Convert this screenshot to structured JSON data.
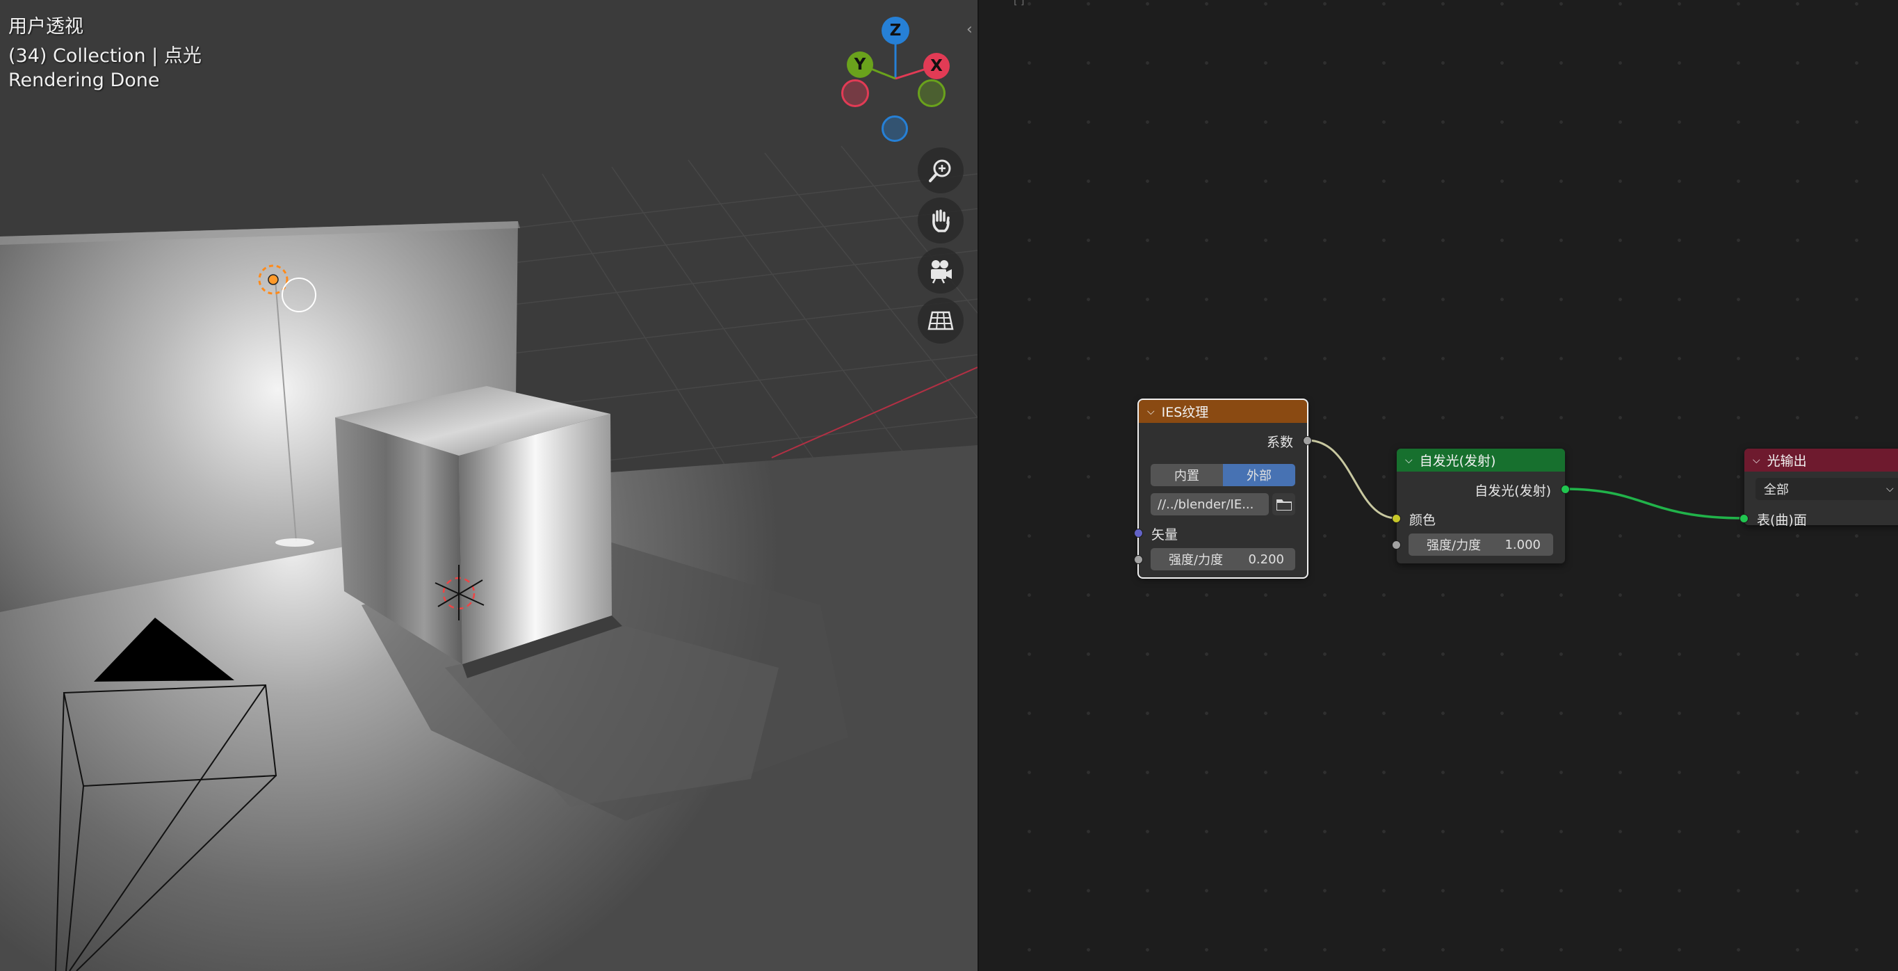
{
  "viewport": {
    "view_name": "用户透视",
    "collection_info": "(34) Collection | 点光",
    "status": "Rendering Done",
    "gizmo": {
      "z": "Z",
      "y": "Y",
      "x": "X"
    },
    "nav_buttons": [
      "zoom-icon",
      "hand-icon",
      "camera-icon",
      "grid-icon"
    ],
    "colors": {
      "x": "#e23b55",
      "y": "#6aa21c",
      "z": "#2680d6"
    }
  },
  "nodes": {
    "ies": {
      "title": "IES纹理",
      "output_factor": "系数",
      "mode_internal": "内置",
      "mode_external": "外部",
      "filepath": "//../blender/IE...",
      "input_vector": "矢量",
      "strength_label": "强度/力度",
      "strength_value": "0.200",
      "header_color": "#8a4a12"
    },
    "emission": {
      "title": "自发光(发射)",
      "output_emission": "自发光(发射)",
      "input_color": "颜色",
      "strength_label": "强度/力度",
      "strength_value": "1.000",
      "header_color": "#17702e"
    },
    "light_output": {
      "title": "光输出",
      "target": "全部",
      "input_surface": "表(曲)面",
      "header_color": "#6e1a2e"
    }
  }
}
